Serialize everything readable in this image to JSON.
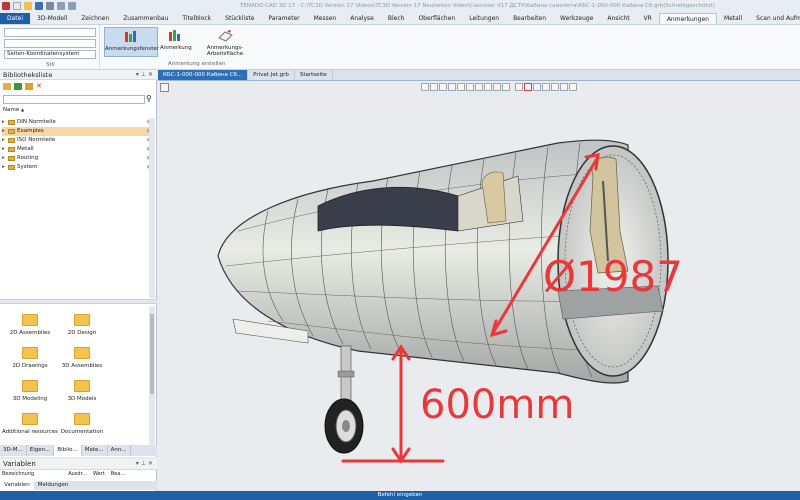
{
  "titlebar": {
    "title": "TENADO CAD 3D 17 - C:\\TC3D Version 17 Videos\\TC3D Version 17 Neuheiten Video\\Cascover V17 ДСТУ\\Кабина самолета\\КБС-1-000-000 Кабина Сб.grb(Schreibgeschützt)"
  },
  "menu": {
    "tabs": [
      "Datei",
      "3D-Modell",
      "Zeichnen",
      "Zusammenbau",
      "Titelblock",
      "Stückliste",
      "Parameter",
      "Messen",
      "Analyse",
      "Blech",
      "Oberflächen",
      "Leitungen",
      "Bearbeiten",
      "Werkzeuge",
      "Ansicht",
      "VR",
      "Anmerkungen",
      "Metall",
      "Scan und Aufmaß"
    ],
    "active": "Anmerkungen"
  },
  "ribbon": {
    "coord_system": "Seiten-Koordinatensystem",
    "style_group": "Stil",
    "buttons": [
      "Anmerkungsfenster",
      "Anmerkung",
      "Anmerkungs-Arbeitsfläche"
    ],
    "group_label": "Anmerkung erstellen"
  },
  "library": {
    "title": "Bibliotheksliste",
    "column_name": "Name",
    "tree": [
      "DIN Normteile",
      "Examples",
      "ISO Normteile",
      "Metall",
      "Routing",
      "System"
    ],
    "selected": "Examples",
    "grid": [
      "2D Assemblies",
      "2D Design",
      "2D Drawings",
      "3D Assemblies",
      "3D Modeling",
      "3D Models",
      "Additional resources",
      "Documentation"
    ]
  },
  "bottom_tabs": [
    "3D-M...",
    "Eigen...",
    "Biblio...",
    "Mate...",
    "Ann..."
  ],
  "variables": {
    "title": "Variablen",
    "columns": [
      "Bezeichnung",
      "Ausdr...",
      "Wert",
      "Bea..."
    ],
    "tabs": [
      "Variablen",
      "Meldungen"
    ]
  },
  "doc_tabs": [
    "КБС-1-000-000 Кабина Сб...",
    "Privat Jet.grb",
    "Startseite"
  ],
  "annotations": {
    "diameter": "Ø1987",
    "height": "600mm"
  },
  "status": "Befehl eingeben",
  "colors": {
    "accent": "#1f5fa8",
    "annotation": "#e8383a",
    "folder": "#f3c24f"
  }
}
